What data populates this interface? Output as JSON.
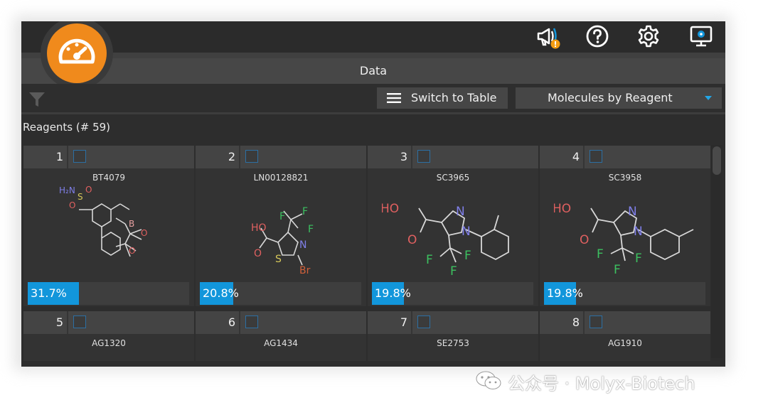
{
  "window": {
    "title": "Data"
  },
  "toolbar": {
    "switch_label": "Switch to Table",
    "view_select": "Molecules by Reagent"
  },
  "icons": {
    "logo": "speedometer-icon",
    "notifications": "megaphone-alert-icon",
    "help": "help-icon",
    "settings": "gear-icon",
    "display": "monitor-settings-icon",
    "filter": "filter-icon"
  },
  "colors": {
    "accent": "#1296db",
    "brand": "#f08a1c",
    "alert": "#f39c12"
  },
  "section": {
    "label": "Reagents (# 59)"
  },
  "cards": [
    {
      "index": "1",
      "id": "BT4079",
      "percent_label": "31.7%",
      "percent": 31.7,
      "atoms": {
        "h2n": "H₂N",
        "s": "S",
        "o1": "O",
        "o2": "O",
        "b": "B",
        "o3": "O",
        "o4": "O"
      }
    },
    {
      "index": "2",
      "id": "LN00128821",
      "percent_label": "20.8%",
      "percent": 20.8,
      "atoms": {
        "ho": "HO",
        "o": "O",
        "f1": "F",
        "f2": "F",
        "f3": "F",
        "n": "N",
        "s": "S",
        "br": "Br"
      }
    },
    {
      "index": "3",
      "id": "SC3965",
      "percent_label": "19.8%",
      "percent": 19.8,
      "atoms": {
        "ho": "HO",
        "o": "O",
        "n1": "N",
        "n2": "N",
        "f1": "F",
        "f2": "F",
        "f3": "F"
      }
    },
    {
      "index": "4",
      "id": "SC3958",
      "percent_label": "19.8%",
      "percent": 19.8,
      "atoms": {
        "ho": "HO",
        "o": "O",
        "n1": "N",
        "n2": "N",
        "f1": "F",
        "f2": "F",
        "f3": "F"
      }
    },
    {
      "index": "5",
      "id": "AG1320"
    },
    {
      "index": "6",
      "id": "AG1434"
    },
    {
      "index": "7",
      "id": "SE2753"
    },
    {
      "index": "8",
      "id": "AG1910"
    }
  ],
  "watermark": {
    "text": "公众号 · Molyx-Biotech"
  }
}
